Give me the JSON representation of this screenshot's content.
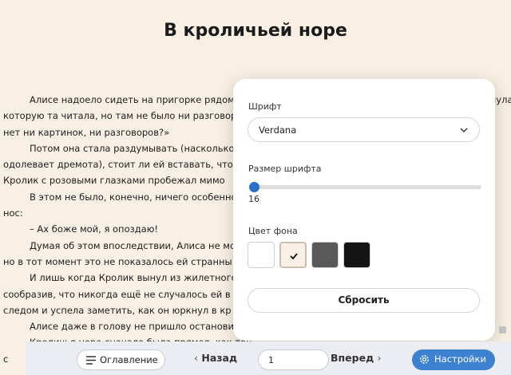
{
  "chapter": {
    "title": "В кроличьей норе"
  },
  "text_lines": [
    {
      "text": "Алисе надоело сидеть на пригорке рядом с сестрой и ничего не делать. Раз-другой она заглянула в книжку, которую читала сестра, но",
      "indent": true
    },
    {
      "text": "которую та читала, но там не было ни разговоров, ни картинок. «Что толку в книжке, если в ней",
      "indent": false
    },
    {
      "text": "нет ни картинок, ни разговоров?»",
      "indent": false
    },
    {
      "text": "Потом она стала раздумывать (насколько во",
      "indent": true
    },
    {
      "text": "одолевает дремота), стоит ли ей вставать, что",
      "indent": false
    },
    {
      "text": "Кролик с розовыми глазками пробежал мимо",
      "indent": false
    },
    {
      "text": "В этом не было, конечно, ничего особенного",
      "indent": true
    },
    {
      "text": "нос:",
      "indent": false
    },
    {
      "text": "– Ах боже мой, я опоздаю!",
      "indent": true
    },
    {
      "text": "Думая об этом впоследствии, Алиса не могла",
      "indent": true
    },
    {
      "text": "но в тот момент это не показалось ей странны",
      "indent": false
    },
    {
      "text": "И лишь когда Кролик вынул из жилетного ка",
      "indent": true
    },
    {
      "text": "сообразив, что никогда ещё не случалось ей в",
      "indent": false
    },
    {
      "text": "следом и успела заметить, как он юркнул в кр",
      "indent": false
    },
    {
      "text": "Алисе даже в голову не пришло остановитьс",
      "indent": true
    },
    {
      "text": "Кроличья нора сначала была прямая, как тон",
      "indent": true
    },
    {
      "text": "с",
      "indent": false
    }
  ],
  "settings": {
    "font_label": "Шрифт",
    "font_value": "Verdana",
    "font_size_label": "Размер шрифта",
    "font_size_value": "16",
    "font_size_fraction": 0.0,
    "bg_color_label": "Цвет фона",
    "bg_colors": [
      "#ffffff",
      "#f8f0e4",
      "#595959",
      "#141414"
    ],
    "selected_bg_index": 1,
    "reset_label": "Сбросить"
  },
  "toolbar": {
    "toc_label": "Оглавление",
    "back_label": "Назад",
    "page_value": "1",
    "next_label": "Вперед",
    "settings_label": "Настройки"
  },
  "colors": {
    "accent": "#3d82d0",
    "page_bg": "#f8f0e4"
  },
  "icons": [
    "chevron-down-icon",
    "check-icon",
    "menu-icon",
    "chevron-left-icon",
    "chevron-right-icon",
    "gear-icon"
  ]
}
